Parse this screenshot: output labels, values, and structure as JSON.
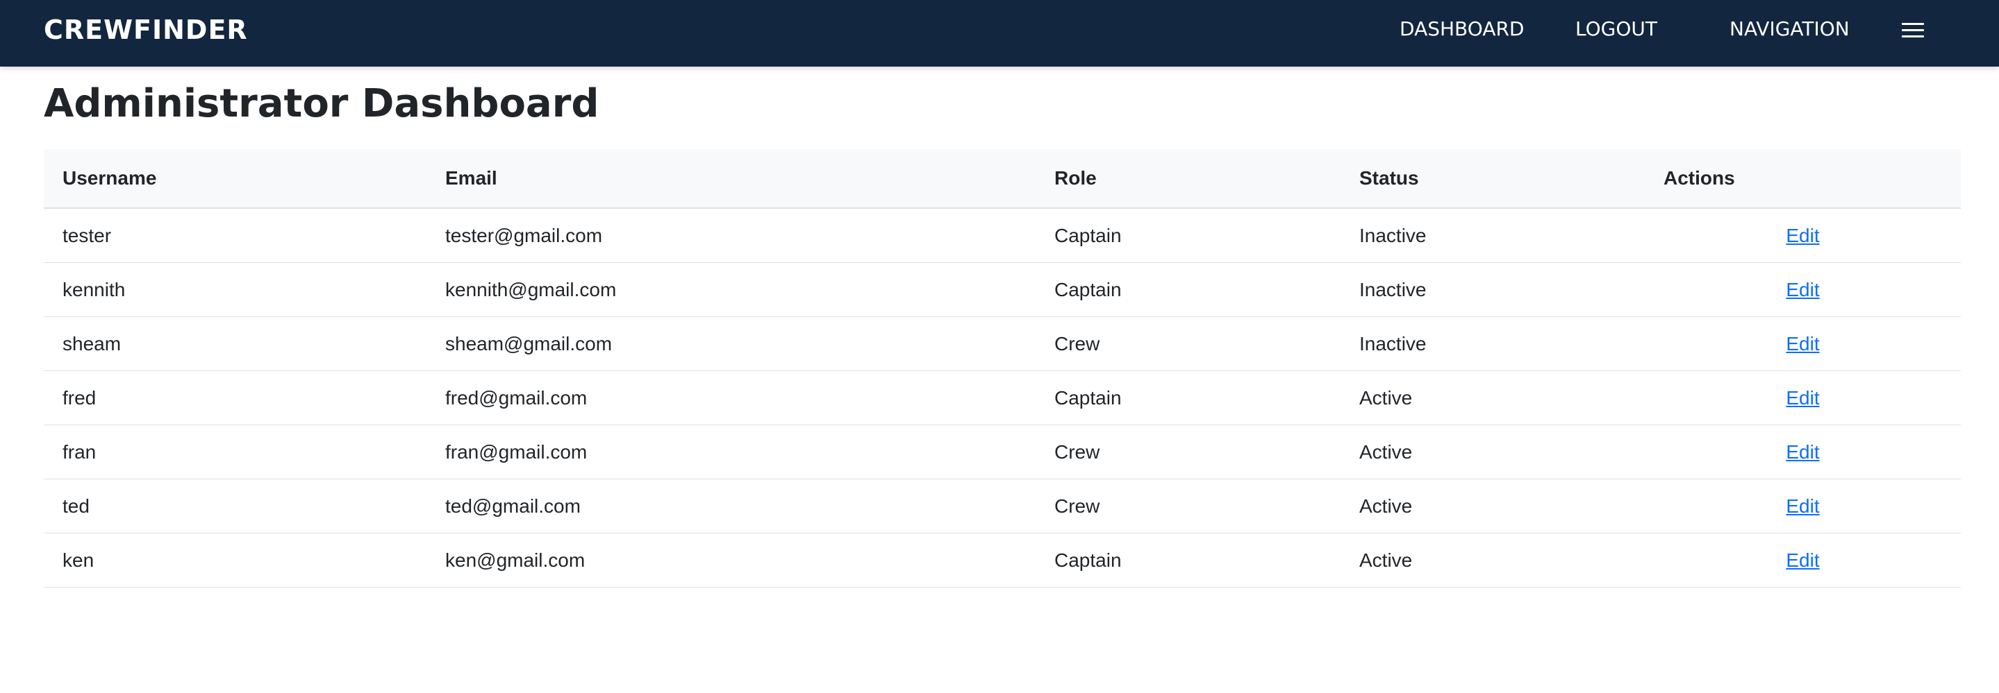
{
  "header": {
    "brand": "CREWFINDER",
    "nav": {
      "dashboard": "DASHBOARD",
      "logout": "LOGOUT",
      "navigation": "NAVIGATION"
    },
    "menu_icon": "hamburger-menu-icon"
  },
  "main": {
    "title": "Administrator Dashboard",
    "table": {
      "columns": [
        "Username",
        "Email",
        "Role",
        "Status",
        "Actions"
      ],
      "rows": [
        {
          "username": "tester",
          "email": "tester@gmail.com",
          "role": "Captain",
          "status": "Inactive",
          "action": "Edit"
        },
        {
          "username": "kennith",
          "email": "kennith@gmail.com",
          "role": "Captain",
          "status": "Inactive",
          "action": "Edit"
        },
        {
          "username": "sheam",
          "email": "sheam@gmail.com",
          "role": "Crew",
          "status": "Inactive",
          "action": "Edit"
        },
        {
          "username": "fred",
          "email": "fred@gmail.com",
          "role": "Captain",
          "status": "Active",
          "action": "Edit"
        },
        {
          "username": "fran",
          "email": "fran@gmail.com",
          "role": "Crew",
          "status": "Active",
          "action": "Edit"
        },
        {
          "username": "ted",
          "email": "ted@gmail.com",
          "role": "Crew",
          "status": "Active",
          "action": "Edit"
        },
        {
          "username": "ken",
          "email": "ken@gmail.com",
          "role": "Captain",
          "status": "Active",
          "action": "Edit"
        }
      ]
    }
  },
  "colors": {
    "navbar_bg": "#132640",
    "link": "#0d6efd",
    "table_header_bg": "#f8f9fa"
  }
}
